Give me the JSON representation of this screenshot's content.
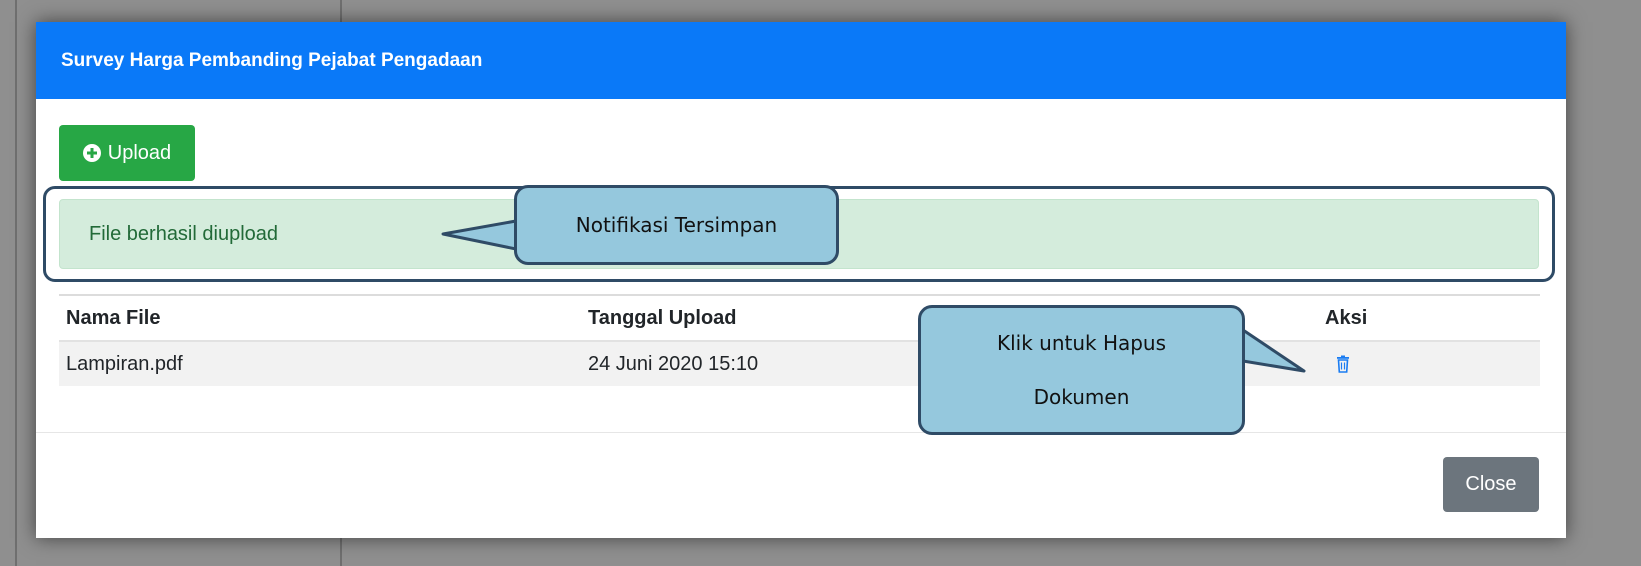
{
  "modal": {
    "title": "Survey Harga Pembanding Pejabat Pengadaan",
    "upload_label": "Upload",
    "alert_text": "File berhasil diupload",
    "close_label": "Close"
  },
  "table": {
    "headers": [
      "Nama File",
      "Tanggal Upload",
      "Aksi"
    ],
    "rows": [
      {
        "file_name": "Lampiran.pdf",
        "upload_date": "24 Juni 2020 15:10",
        "action_icon": "trash-icon"
      }
    ]
  },
  "callouts": {
    "notification": "Notifikasi Tersimpan",
    "delete_line1": "Klik untuk Hapus",
    "delete_line2": "Dokumen"
  },
  "colors": {
    "header": "#0a79f8",
    "upload_button": "#27a745",
    "alert_bg": "#d4ecdc",
    "close_button": "#6c757d",
    "callout_fill": "#95c8dd",
    "callout_border": "#2f4b66"
  }
}
